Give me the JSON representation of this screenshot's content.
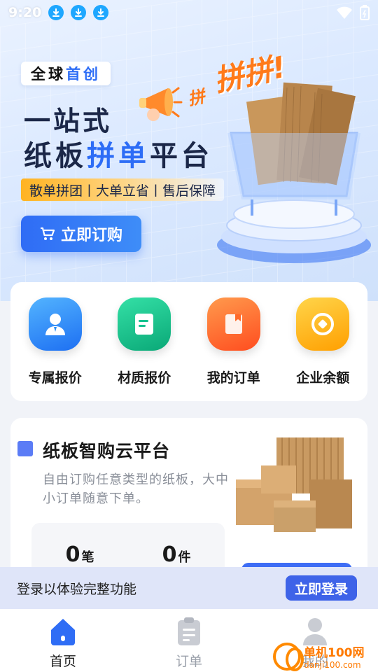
{
  "status_bar": {
    "time": "9:20"
  },
  "hero": {
    "tag_prefix": "全球",
    "tag_accent": "首创",
    "title_line1": "一站式",
    "title_line2_a": "纸板",
    "title_line2_b": "拼单",
    "title_line2_c": "平台",
    "slogan": "散单拼团丨大单立省丨售后保障",
    "buy_button": "立即订购",
    "promo_big": "拼拼!",
    "promo_small": "拼"
  },
  "quick_menu": [
    {
      "label": "专属报价",
      "icon": "user-quote-icon",
      "color": "#2a8df5"
    },
    {
      "label": "材质报价",
      "icon": "document-icon",
      "color": "#16c28f"
    },
    {
      "label": "我的订单",
      "icon": "order-book-icon",
      "color": "#ff6a2a"
    },
    {
      "label": "企业余额",
      "icon": "coin-icon",
      "color": "#ffb400"
    }
  ],
  "platform": {
    "title": "纸板智购云平台",
    "description": "自由订购任意类型的纸板，大中小订单随意下单。",
    "stats": [
      {
        "value": "0",
        "unit": "笔"
      },
      {
        "value": "0",
        "unit": "件"
      }
    ]
  },
  "login_banner": {
    "text": "登录以体验完整功能",
    "button": "立即登录"
  },
  "bottom_nav": [
    {
      "label": "首页",
      "icon": "home-icon",
      "active": true
    },
    {
      "label": "订单",
      "icon": "clipboard-icon",
      "active": false
    },
    {
      "label": "我的",
      "icon": "user-icon",
      "active": false
    }
  ],
  "watermark": {
    "main": "单机100网",
    "sub": "danji100.com"
  }
}
